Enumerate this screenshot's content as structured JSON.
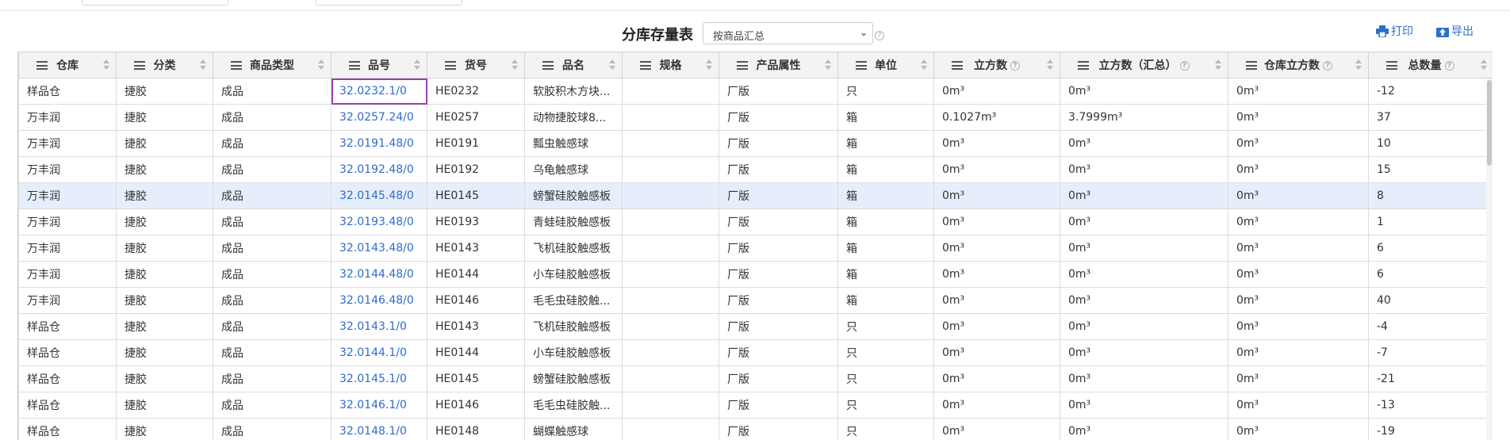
{
  "page": {
    "title": "分库存量表"
  },
  "view_select": {
    "value": "按商品汇总"
  },
  "toolbar": {
    "print_label": "打印",
    "export_label": "导出"
  },
  "icons": {
    "print": "printer-icon",
    "export": "upload-icon",
    "help": "help-circle-icon",
    "column_menu": "hamburger-menu-icon",
    "sort": "sort-icon"
  },
  "colors": {
    "link": "#2f6bd1",
    "selected_row": "#e7eefb",
    "focus_border": "#9c3fb0",
    "header_bg": "#f3f3f3"
  },
  "table": {
    "columns": [
      "仓库",
      "分类",
      "商品类型",
      "品号",
      "货号",
      "品名",
      "规格",
      "产品属性",
      "单位",
      "立方数",
      "立方数（汇总）",
      "仓库立方数",
      "总数量"
    ],
    "rows": [
      [
        "样品仓",
        "捷胶",
        "成品",
        "32.0232.1/0",
        "HE0232",
        "软胶积木方块...",
        "",
        "厂版",
        "只",
        "0m³",
        "0m³",
        "0m³",
        "-12"
      ],
      [
        "万丰润",
        "捷胶",
        "成品",
        "32.0257.24/0",
        "HE0257",
        "动物捷胶球8...",
        "",
        "厂版",
        "箱",
        "0.1027m³",
        "3.7999m³",
        "0m³",
        "37"
      ],
      [
        "万丰润",
        "捷胶",
        "成品",
        "32.0191.48/0",
        "HE0191",
        "瓢虫触感球",
        "",
        "厂版",
        "箱",
        "0m³",
        "0m³",
        "0m³",
        "10"
      ],
      [
        "万丰润",
        "捷胶",
        "成品",
        "32.0192.48/0",
        "HE0192",
        "乌龟触感球",
        "",
        "厂版",
        "箱",
        "0m³",
        "0m³",
        "0m³",
        "15"
      ],
      [
        "万丰润",
        "捷胶",
        "成品",
        "32.0145.48/0",
        "HE0145",
        "螃蟹硅胶触感板",
        "",
        "厂版",
        "箱",
        "0m³",
        "0m³",
        "0m³",
        "8"
      ],
      [
        "万丰润",
        "捷胶",
        "成品",
        "32.0193.48/0",
        "HE0193",
        "青蛙硅胶触感板",
        "",
        "厂版",
        "箱",
        "0m³",
        "0m³",
        "0m³",
        "1"
      ],
      [
        "万丰润",
        "捷胶",
        "成品",
        "32.0143.48/0",
        "HE0143",
        "飞机硅胶触感板",
        "",
        "厂版",
        "箱",
        "0m³",
        "0m³",
        "0m³",
        "6"
      ],
      [
        "万丰润",
        "捷胶",
        "成品",
        "32.0144.48/0",
        "HE0144",
        "小车硅胶触感板",
        "",
        "厂版",
        "箱",
        "0m³",
        "0m³",
        "0m³",
        "6"
      ],
      [
        "万丰润",
        "捷胶",
        "成品",
        "32.0146.48/0",
        "HE0146",
        "毛毛虫硅胶触...",
        "",
        "厂版",
        "箱",
        "0m³",
        "0m³",
        "0m³",
        "40"
      ],
      [
        "样品仓",
        "捷胶",
        "成品",
        "32.0143.1/0",
        "HE0143",
        "飞机硅胶触感板",
        "",
        "厂版",
        "只",
        "0m³",
        "0m³",
        "0m³",
        "-4"
      ],
      [
        "样品仓",
        "捷胶",
        "成品",
        "32.0144.1/0",
        "HE0144",
        "小车硅胶触感板",
        "",
        "厂版",
        "只",
        "0m³",
        "0m³",
        "0m³",
        "-7"
      ],
      [
        "样品仓",
        "捷胶",
        "成品",
        "32.0145.1/0",
        "HE0145",
        "螃蟹硅胶触感板",
        "",
        "厂版",
        "只",
        "0m³",
        "0m³",
        "0m³",
        "-21"
      ],
      [
        "样品仓",
        "捷胶",
        "成品",
        "32.0146.1/0",
        "HE0146",
        "毛毛虫硅胶触...",
        "",
        "厂版",
        "只",
        "0m³",
        "0m³",
        "0m³",
        "-13"
      ],
      [
        "样品仓",
        "捷胶",
        "成品",
        "32.0148.1/0",
        "HE0148",
        "蝴蝶触感球",
        "",
        "厂版",
        "只",
        "0m³",
        "0m³",
        "0m³",
        "-19"
      ]
    ]
  }
}
